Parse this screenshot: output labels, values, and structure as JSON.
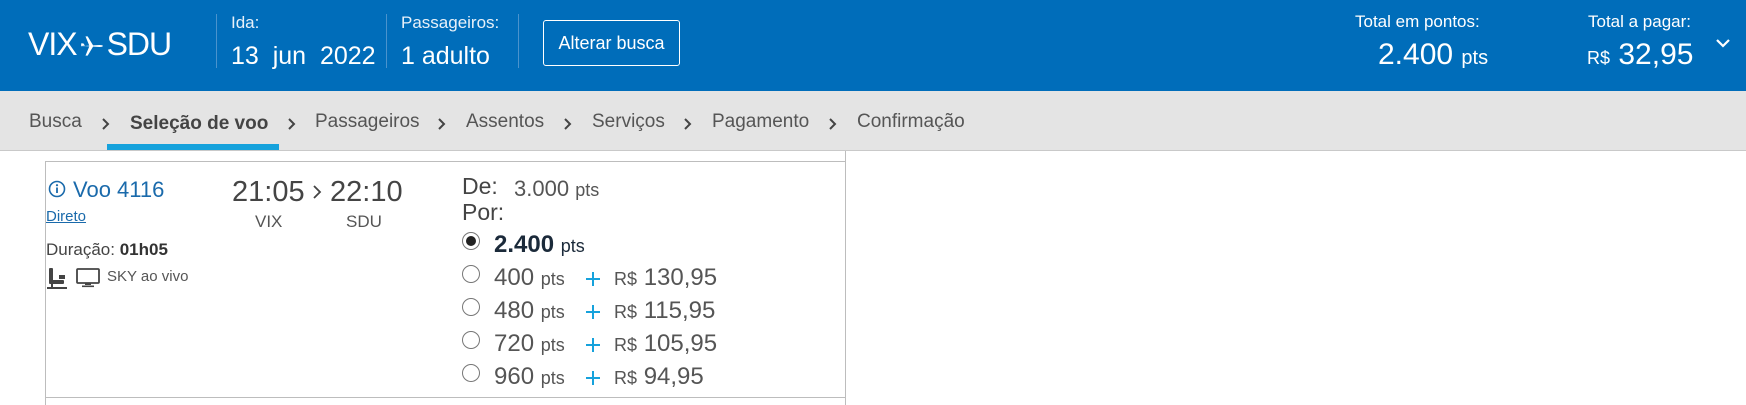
{
  "header": {
    "origin": "VIX",
    "destination": "SDU",
    "ida_label": "Ida:",
    "ida_value": "13  jun  2022",
    "passengers_label": "Passageiros:",
    "passengers_value": "1 adulto",
    "change_search_label": "Alterar busca",
    "total_points_label": "Total em pontos:",
    "total_points_value": "2.400",
    "total_points_unit": "pts",
    "total_pay_label": "Total a pagar:",
    "total_pay_currency": "R$",
    "total_pay_value": "32,95"
  },
  "breadcrumb": [
    {
      "label": "Busca",
      "active": false
    },
    {
      "label": "Seleção de voo",
      "active": true
    },
    {
      "label": "Passageiros",
      "active": false
    },
    {
      "label": "Assentos",
      "active": false
    },
    {
      "label": "Serviços",
      "active": false
    },
    {
      "label": "Pagamento",
      "active": false
    },
    {
      "label": "Confirmação",
      "active": false
    }
  ],
  "flight": {
    "title": "Voo 4116",
    "type": "Direto",
    "duration_label": "Duração:",
    "duration_value": "01h05",
    "entertainment": "SKY ao vivo",
    "depart_time": "21:05",
    "arrive_time": "22:10",
    "depart_code": "VIX",
    "arrive_code": "SDU",
    "price_from_label": "De:",
    "price_from_value": "3.000",
    "price_for_label": "Por:",
    "unit": "pts",
    "currency": "R$",
    "options": [
      {
        "points": "2.400",
        "money": "",
        "selected": true
      },
      {
        "points": "400",
        "money": "130,95",
        "selected": false
      },
      {
        "points": "480",
        "money": "115,95",
        "selected": false
      },
      {
        "points": "720",
        "money": "105,95",
        "selected": false
      },
      {
        "points": "960",
        "money": "94,95",
        "selected": false
      }
    ]
  },
  "colors": {
    "header_bg": "#006dba",
    "accent": "#16a2dc",
    "link": "#1a6aab"
  }
}
